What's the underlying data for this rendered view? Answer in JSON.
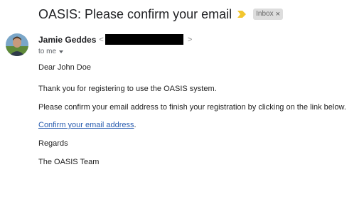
{
  "email": {
    "subject": "OASIS: Please confirm your email",
    "label": "Inbox",
    "label_close": "×",
    "sender": {
      "name": "Jamie Geddes",
      "email_open": "<",
      "email_close": ">"
    },
    "recipient_line": "to me",
    "body": {
      "greeting": "Dear John Doe",
      "thanks": "Thank you for registering to use the OASIS system.",
      "instruction": "Please confirm your email address to finish your registration by clicking on the link below.",
      "link_text": "Confirm your email address",
      "link_suffix": ".",
      "closing": "Regards",
      "signature": "The OASIS Team"
    }
  },
  "colors": {
    "importance_marker": "#f2c62f",
    "link": "#2a5db0",
    "label_bg": "#dddddd"
  },
  "icons": {
    "importance": "importance-marker-icon",
    "avatar": "sender-avatar",
    "caret": "chevron-down-icon"
  }
}
